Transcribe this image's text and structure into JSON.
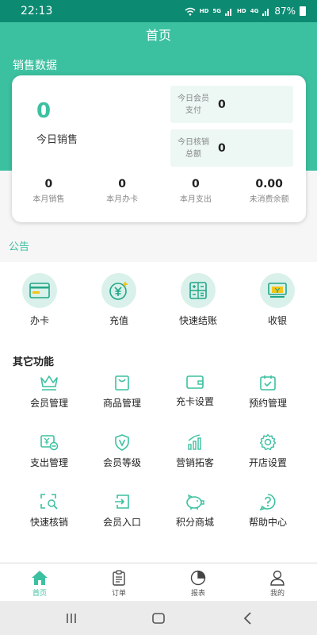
{
  "status_bar": {
    "time": "22:13",
    "battery": "87%",
    "net_label_1": "HD",
    "net_label_2": "5G",
    "net_label_3": "HD",
    "net_label_4": "4G"
  },
  "header": {
    "title": "首页"
  },
  "sales": {
    "section_title": "销售数据",
    "today_sales_value": "0",
    "today_sales_label": "今日销售",
    "member_pay": {
      "label_line1": "今日会员",
      "label_line2": "支付",
      "value": "0"
    },
    "verify_total": {
      "label_line1": "今日核销",
      "label_line2": "总额",
      "value": "0"
    },
    "stats": [
      {
        "value": "0",
        "label": "本月销售"
      },
      {
        "value": "0",
        "label": "本月办卡"
      },
      {
        "value": "0",
        "label": "本月支出"
      },
      {
        "value": "0.00",
        "label": "未消费余额"
      }
    ]
  },
  "notice": {
    "label": "公告"
  },
  "quick_actions": [
    {
      "label": "办卡",
      "icon": "card-icon"
    },
    {
      "label": "充值",
      "icon": "yuan-coin-icon"
    },
    {
      "label": "快速结账",
      "icon": "calculator-icon"
    },
    {
      "label": "收银",
      "icon": "cash-register-icon"
    }
  ],
  "other_functions": {
    "title": "其它功能",
    "items": [
      {
        "label": "会员管理",
        "icon": "crown-icon"
      },
      {
        "label": "商品管理",
        "icon": "shopping-bag-icon"
      },
      {
        "label": "充卡设置",
        "icon": "wallet-icon"
      },
      {
        "label": "预约管理",
        "icon": "calendar-check-icon"
      },
      {
        "label": "支出管理",
        "icon": "expense-icon"
      },
      {
        "label": "会员等级",
        "icon": "shield-v-icon"
      },
      {
        "label": "营销拓客",
        "icon": "bar-chart-icon"
      },
      {
        "label": "开店设置",
        "icon": "gear-icon"
      },
      {
        "label": "快速核销",
        "icon": "scan-search-icon"
      },
      {
        "label": "会员入口",
        "icon": "login-icon"
      },
      {
        "label": "积分商城",
        "icon": "piggy-bank-icon"
      },
      {
        "label": "帮助中心",
        "icon": "help-icon"
      }
    ]
  },
  "tab_bar": {
    "tabs": [
      {
        "label": "首页",
        "icon": "home-icon",
        "active": true
      },
      {
        "label": "订单",
        "icon": "clipboard-icon",
        "active": false
      },
      {
        "label": "报表",
        "icon": "pie-chart-icon",
        "active": false
      },
      {
        "label": "我的",
        "icon": "user-icon",
        "active": false
      }
    ]
  },
  "colors": {
    "accent": "#3cc1a0",
    "status_bar": "#0c8a72",
    "icon_bg": "#d9f1ea",
    "mini_box_bg": "#edf8f5"
  }
}
